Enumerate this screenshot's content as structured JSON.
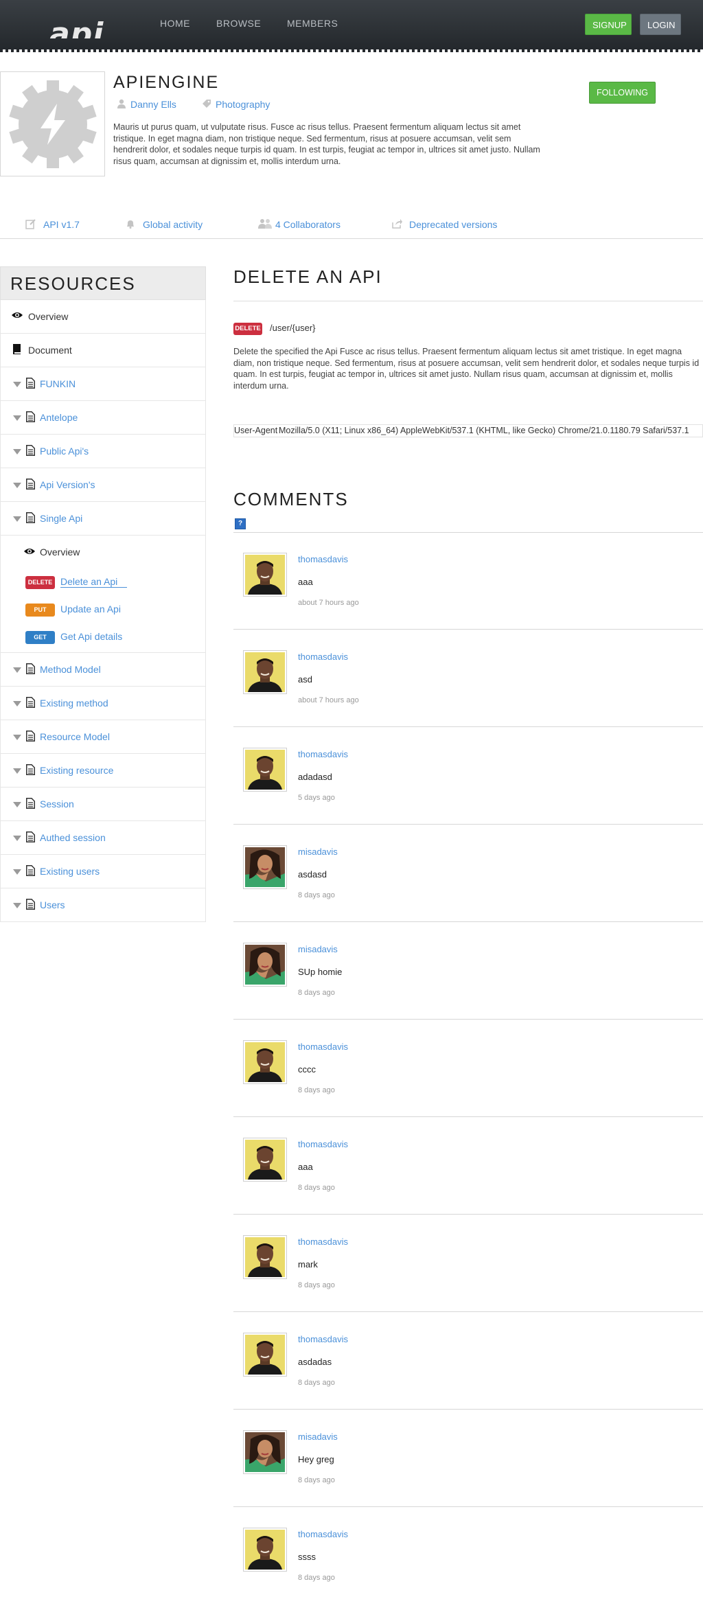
{
  "topbar": {
    "logo_text": "api",
    "nav": [
      "HOME",
      "BROWSE",
      "MEMBERS"
    ],
    "signup_label": "SIGNUP",
    "login_label": "LOGIN"
  },
  "profile": {
    "title": "APIENGINE",
    "owner": "Danny Ells",
    "category": "Photography",
    "description": "Mauris ut purus quam, ut vulputate risus. Fusce ac risus tellus. Praesent fermentum aliquam lectus sit amet tristique. In eget magna diam, non tristique neque. Sed fermentum, risus at posuere accumsan, velit sem hendrerit dolor, et sodales neque turpis id quam. In est turpis, feugiat ac tempor in, ultrices sit amet justo. Nullam risus quam, accumsan at dignissim et, mollis interdum urna.",
    "following_label": "FOLLOWING"
  },
  "subnav": [
    "API v1.7",
    "Global activity",
    "4 Collaborators",
    "Deprecated versions"
  ],
  "sidebar": {
    "title": "RESOURCES",
    "overview": "Overview",
    "document": "Document",
    "groups_top": [
      "FUNKIN",
      "Antelope",
      "Public Api's",
      "Api Version's",
      "Single Api"
    ],
    "sub_overview": "Overview",
    "methods": [
      {
        "badge": "DELETE",
        "label": "Delete an Api"
      },
      {
        "badge": "PUT",
        "label": "Update an Api"
      },
      {
        "badge": "GET",
        "label": "Get Api details"
      }
    ],
    "groups_bottom": [
      "Method Model",
      "Existing method",
      "Resource Model",
      "Existing resource",
      "Session",
      "Authed session",
      "Existing users",
      "Users"
    ]
  },
  "main": {
    "section_title": "DELETE AN API",
    "endpoint_badge": "DELETE",
    "endpoint_path": "/user/{user}",
    "endpoint_description": "Delete the specified the Api Fusce ac risus tellus. Praesent fermentum aliquam lectus sit amet tristique. In eget magna diam, non tristique neque. Sed fermentum, risus at posuere accumsan, velit sem hendrerit dolor, et sodales neque turpis id quam. In est turpis, feugiat ac tempor in, ultrices sit amet justo. Nullam risus quam, accumsan at dignissim et, mollis interdum urna.",
    "header_key": "User-Agent",
    "header_value": "Mozilla/5.0 (X11; Linux x86_64) AppleWebKit/537.1 (KHTML, like Gecko) Chrome/21.0.1180.79 Safari/537.1",
    "comments_title": "COMMENTS",
    "help_glyph": "?"
  },
  "comments": [
    {
      "author": "thomasdavis",
      "text": "aaa",
      "time": "about 7 hours ago",
      "avatar": "man"
    },
    {
      "author": "thomasdavis",
      "text": "asd",
      "time": "about 7 hours ago",
      "avatar": "man"
    },
    {
      "author": "thomasdavis",
      "text": "adadasd",
      "time": "5 days ago",
      "avatar": "man"
    },
    {
      "author": "misadavis",
      "text": "asdasd",
      "time": "8 days ago",
      "avatar": "woman"
    },
    {
      "author": "misadavis",
      "text": "SUp homie",
      "time": "8 days ago",
      "avatar": "woman"
    },
    {
      "author": "thomasdavis",
      "text": "cccc",
      "time": "8 days ago",
      "avatar": "man"
    },
    {
      "author": "thomasdavis",
      "text": "aaa",
      "time": "8 days ago",
      "avatar": "man"
    },
    {
      "author": "thomasdavis",
      "text": "mark",
      "time": "8 days ago",
      "avatar": "man"
    },
    {
      "author": "thomasdavis",
      "text": "asdadas",
      "time": "8 days ago",
      "avatar": "man"
    },
    {
      "author": "misadavis",
      "text": "Hey greg",
      "time": "8 days ago",
      "avatar": "woman"
    },
    {
      "author": "thomasdavis",
      "text": "ssss",
      "time": "8 days ago",
      "avatar": "man"
    }
  ],
  "colors": {
    "accent": "#4a90d9",
    "green": "#5ab946",
    "delete": "#cc2f3f",
    "put": "#e8891d",
    "get": "#2f7fc6"
  }
}
